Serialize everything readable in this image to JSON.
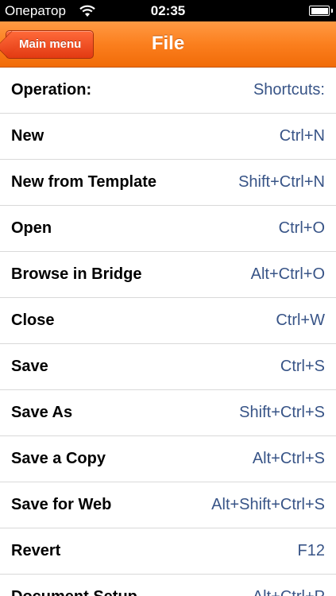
{
  "status_bar": {
    "carrier": "Оператор",
    "time": "02:35"
  },
  "nav": {
    "title": "File",
    "back_label": "Main menu"
  },
  "colors": {
    "nav_orange": "#f97a19",
    "back_red": "#e6421a",
    "shortcut_blue": "#385487"
  },
  "list": {
    "header": {
      "operation": "Operation:",
      "shortcut": "Shortcuts:"
    },
    "items": [
      {
        "operation": "New",
        "shortcut": "Ctrl+N"
      },
      {
        "operation": "New from Template",
        "shortcut": "Shift+Ctrl+N"
      },
      {
        "operation": "Open",
        "shortcut": "Ctrl+O"
      },
      {
        "operation": "Browse in Bridge",
        "shortcut": "Alt+Ctrl+O"
      },
      {
        "operation": "Close",
        "shortcut": "Ctrl+W"
      },
      {
        "operation": "Save",
        "shortcut": "Ctrl+S"
      },
      {
        "operation": "Save As",
        "shortcut": "Shift+Ctrl+S"
      },
      {
        "operation": "Save a Copy",
        "shortcut": "Alt+Ctrl+S"
      },
      {
        "operation": "Save for Web",
        "shortcut": "Alt+Shift+Ctrl+S"
      },
      {
        "operation": "Revert",
        "shortcut": "F12"
      },
      {
        "operation": "Document Setup",
        "shortcut": "Alt+Ctrl+P"
      }
    ]
  }
}
